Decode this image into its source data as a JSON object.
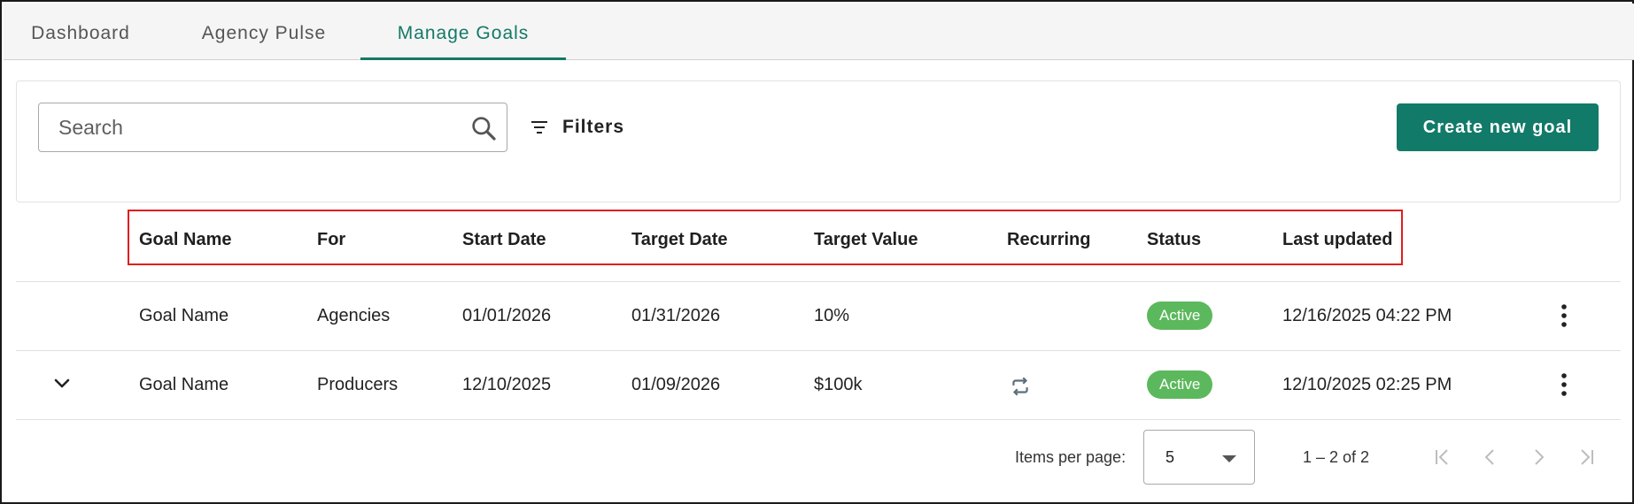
{
  "tabs": [
    {
      "label": "Dashboard",
      "active": false
    },
    {
      "label": "Agency Pulse",
      "active": false
    },
    {
      "label": "Manage Goals",
      "active": true
    }
  ],
  "toolbar": {
    "search_placeholder": "Search",
    "filters_label": "Filters",
    "create_label": "Create new goal"
  },
  "table": {
    "columns": [
      "Goal Name",
      "For",
      "Start Date",
      "Target Date",
      "Target Value",
      "Recurring",
      "Status",
      "Last updated"
    ],
    "rows": [
      {
        "goal_name": "Goal Name",
        "for": "Agencies",
        "start_date": "01/01/2026",
        "target_date": "01/31/2026",
        "target_value": "10%",
        "recurring": false,
        "status": "Active",
        "last_updated": "12/16/2025 04:22 PM",
        "expandable": false
      },
      {
        "goal_name": "Goal Name",
        "for": "Producers",
        "start_date": "12/10/2025",
        "target_date": "01/09/2026",
        "target_value": "$100k",
        "recurring": true,
        "status": "Active",
        "last_updated": "12/10/2025 02:25 PM",
        "expandable": true
      }
    ]
  },
  "paginator": {
    "items_per_page_label": "Items per page:",
    "items_per_page": "5",
    "range_label": "1 – 2 of 2"
  },
  "icons": {
    "search": "search-icon",
    "filters": "filter-lines-icon",
    "expand": "chevron-down-icon",
    "recurring": "repeat-icon",
    "row_menu": "more-vertical-icon",
    "first": "first-page-icon",
    "prev": "chevron-left-icon",
    "next": "chevron-right-icon",
    "last": "last-page-icon"
  },
  "colors": {
    "accent": "#137a66",
    "button": "#127a68",
    "status_active": "#5cb85c",
    "highlight": "#e01e1e",
    "pager_disabled": "#bdbdbd"
  }
}
